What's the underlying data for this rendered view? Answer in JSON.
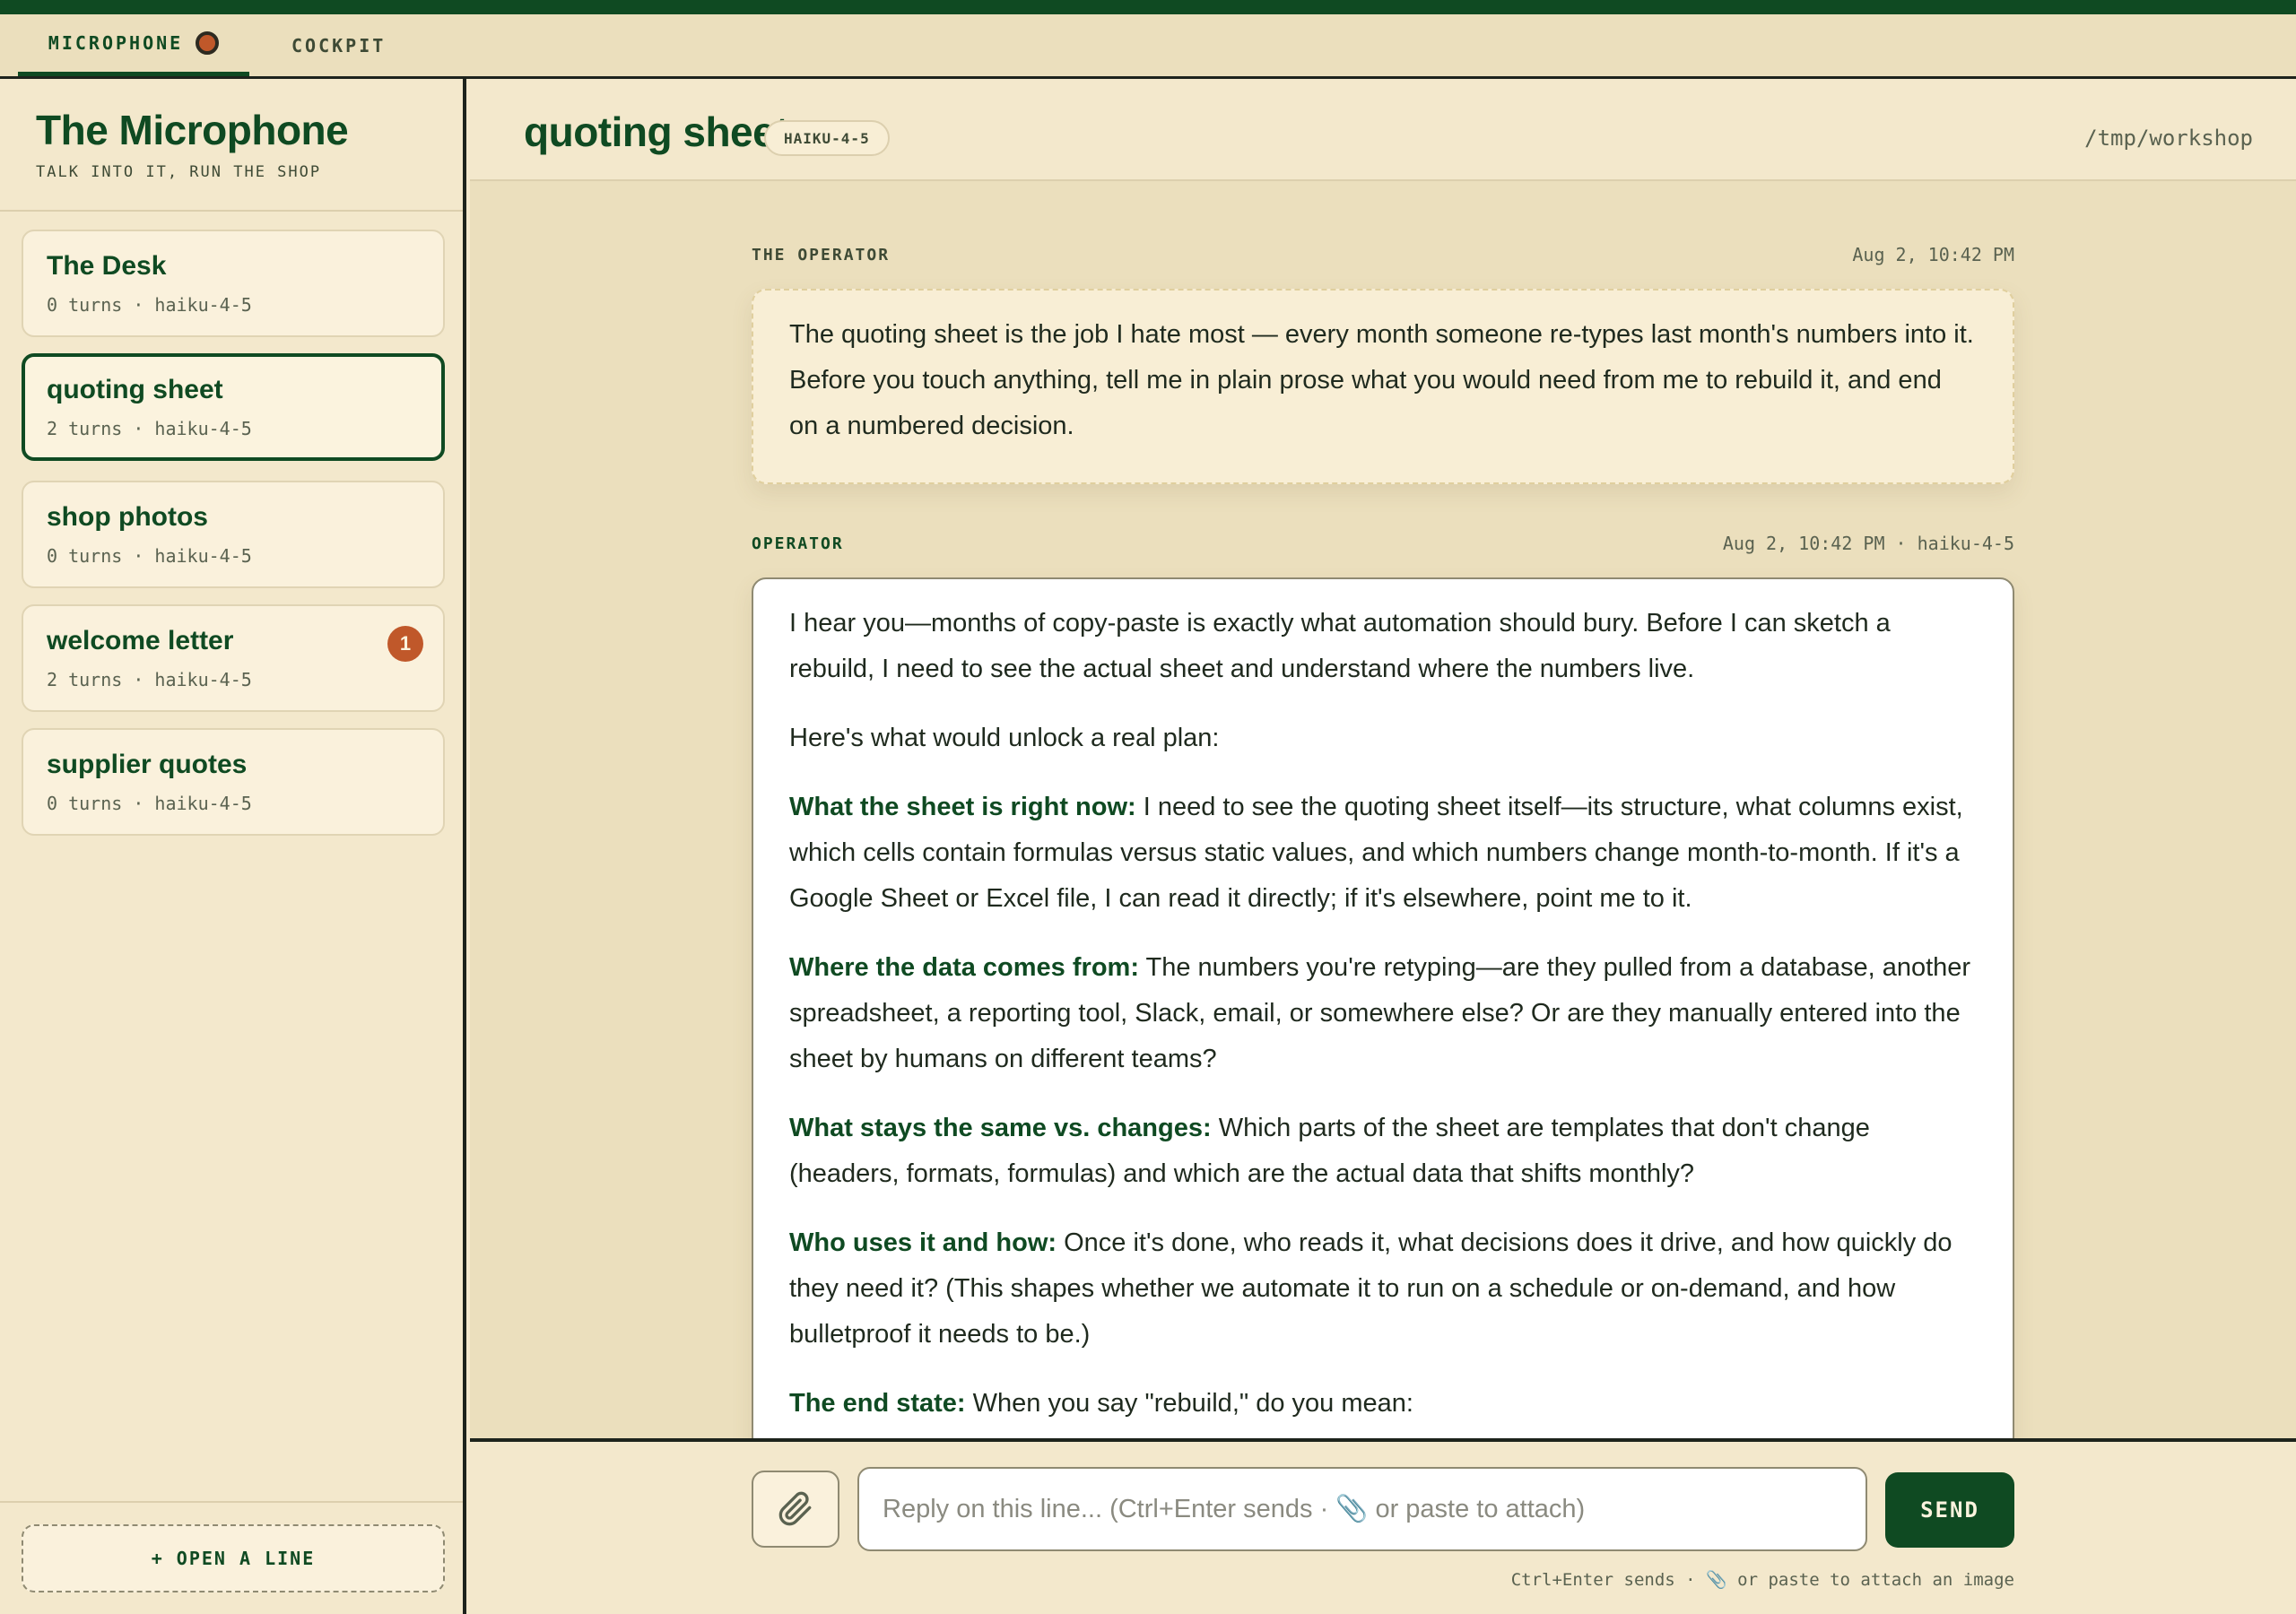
{
  "tabs": {
    "microphone": "MICROPHONE",
    "cockpit": "COCKPIT"
  },
  "sidebar": {
    "title": "The Microphone",
    "subtitle": "TALK INTO IT, RUN THE SHOP",
    "items": [
      {
        "title": "The Desk",
        "meta": "0 turns · haiku-4-5"
      },
      {
        "title": "quoting sheet",
        "meta": "2 turns · haiku-4-5"
      },
      {
        "title": "shop photos",
        "meta": "0 turns · haiku-4-5"
      },
      {
        "title": "welcome letter",
        "meta": "2 turns · haiku-4-5",
        "badge": "1"
      },
      {
        "title": "supplier quotes",
        "meta": "0 turns · haiku-4-5"
      }
    ],
    "open_line": "+ OPEN A LINE"
  },
  "header": {
    "title": "quoting sheet",
    "model": "HAIKU-4-5",
    "path": "/tmp/workshop"
  },
  "messages": {
    "user": {
      "label": "THE OPERATOR",
      "time": "Aug 2, 10:42 PM",
      "text": "The quoting sheet is the job I hate most — every month someone re-types last month's numbers into it. Before you touch anything, tell me in plain prose what you would need from me to rebuild it, and end on a numbered decision."
    },
    "assistant": {
      "label": "OPERATOR",
      "time": "Aug 2, 10:42 PM · haiku-4-5",
      "p1": "I hear you—months of copy-paste is exactly what automation should bury. Before I can sketch a rebuild, I need to see the actual sheet and understand where the numbers live.",
      "p2": "Here's what would unlock a real plan:",
      "sections": [
        {
          "head": "What the sheet is right now:",
          "body": " I need to see the quoting sheet itself—its structure, what columns exist, which cells contain formulas versus static values, and which numbers change month-to-month. If it's a Google Sheet or Excel file, I can read it directly; if it's elsewhere, point me to it."
        },
        {
          "head": "Where the data comes from:",
          "body": " The numbers you're retyping—are they pulled from a database, another spreadsheet, a reporting tool, Slack, email, or somewhere else? Or are they manually entered into the sheet by humans on different teams?"
        },
        {
          "head": "What stays the same vs. changes:",
          "body": " Which parts of the sheet are templates that don't change (headers, formats, formulas) and which are the actual data that shifts monthly?"
        },
        {
          "head": "Who uses it and how:",
          "body": " Once it's done, who reads it, what decisions does it drive, and how quickly do they need it? (This shapes whether we automate it to run on a schedule or on-demand, and how bulletproof it needs to be.)"
        },
        {
          "head": "The end state:",
          "body": " When you say \"rebuild,\" do you mean:"
        }
      ]
    }
  },
  "composer": {
    "placeholder": "Reply on this line... (Ctrl+Enter sends · 📎 or paste to attach)",
    "send": "SEND",
    "hint": "Ctrl+Enter sends · 📎 or paste to attach an image"
  },
  "colors": {
    "brand_green": "#0f4a22",
    "accent_orange": "#c0582a",
    "paper": "#f3e8cc"
  },
  "icons": {
    "attach": "paperclip-icon",
    "recording": "record-dot-icon"
  }
}
